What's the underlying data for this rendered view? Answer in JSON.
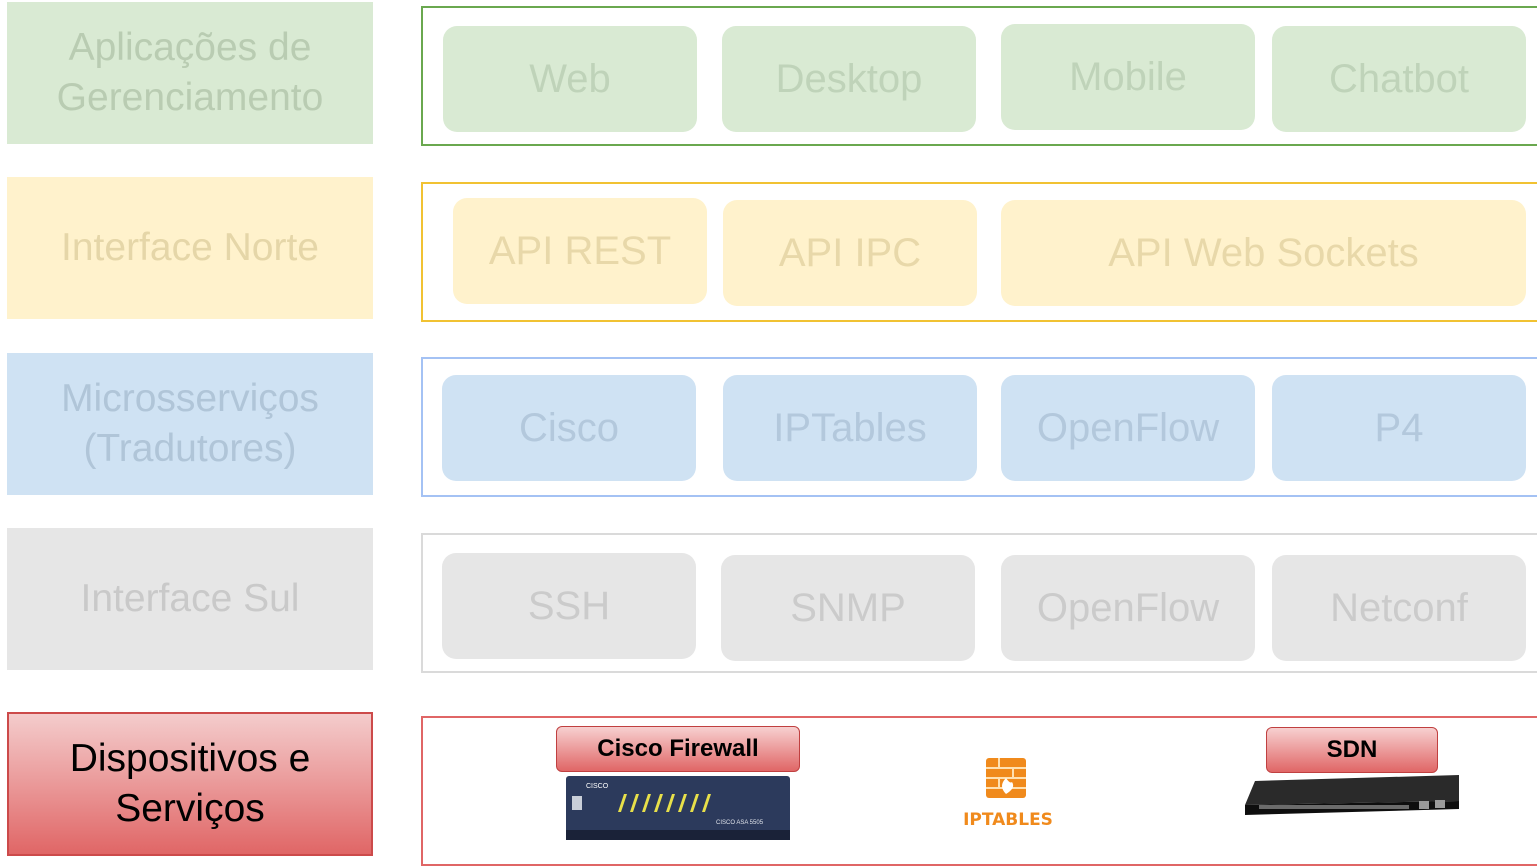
{
  "layers": [
    {
      "label_line1": "Aplicações de",
      "label_line2": "Gerenciamento",
      "items": [
        "Web",
        "Desktop",
        "Mobile",
        "Chatbot"
      ]
    },
    {
      "label_line1": "Interface Norte",
      "label_line2": "",
      "items": [
        "API REST",
        "API IPC",
        "API Web Sockets"
      ]
    },
    {
      "label_line1": "Microsserviços",
      "label_line2": "(Tradutores)",
      "items": [
        "Cisco",
        "IPTables",
        "OpenFlow",
        "P4"
      ]
    },
    {
      "label_line1": "Interface Sul",
      "label_line2": "",
      "items": [
        "SSH",
        "SNMP",
        "OpenFlow",
        "Netconf"
      ]
    },
    {
      "label_line1": "Dispositivos e",
      "label_line2": "Serviços",
      "devices": {
        "cisco_tag": "Cisco Firewall",
        "cisco_device_text": "CISCO ASA 5505",
        "cisco_logo": "CISCO",
        "iptables_logo": "IPTABLES",
        "sdn_tag": "SDN"
      }
    }
  ],
  "colors": {
    "green": "#d9ead3",
    "yellow": "#fff2cc",
    "blue": "#cfe2f3",
    "gray": "#e6e6e6",
    "red": "#e06666"
  }
}
